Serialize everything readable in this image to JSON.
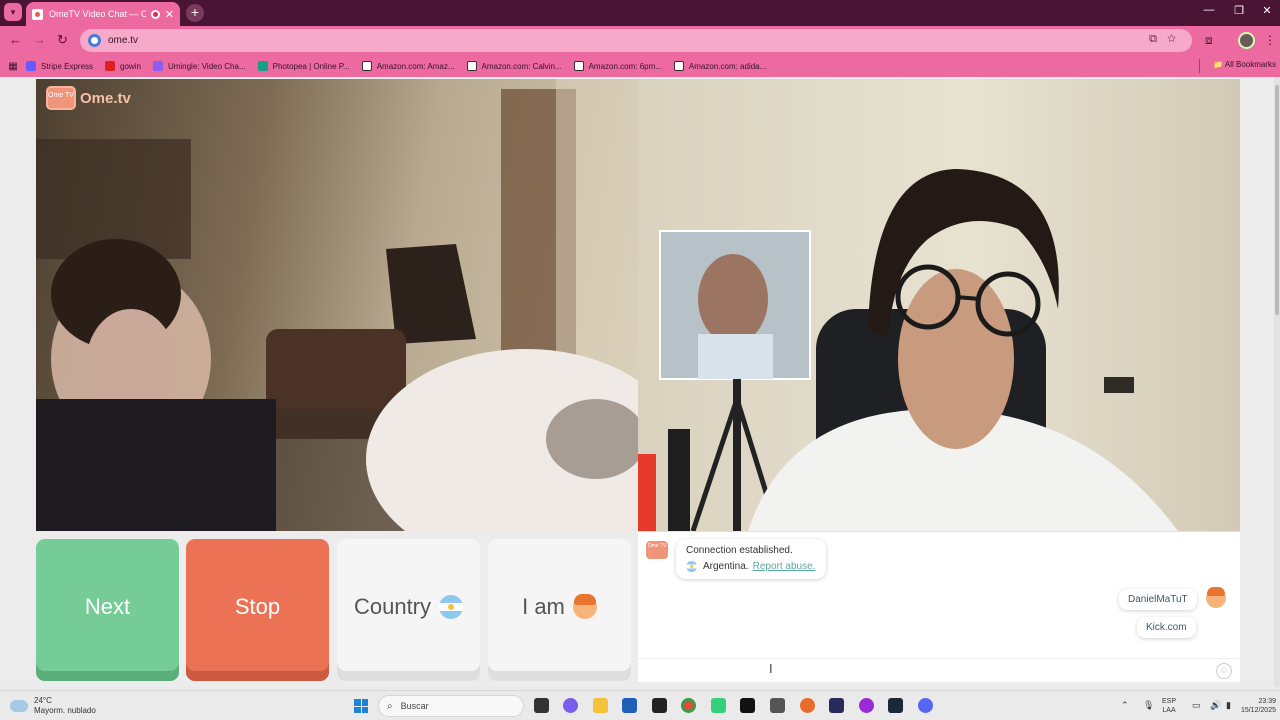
{
  "browser": {
    "tab_title": "OmeTV Video Chat — Ome",
    "new_tab_symbol": "+",
    "url": "ome.tv",
    "bookmarks": [
      {
        "label": "Stripe Express",
        "color": "#635bff"
      },
      {
        "label": "gowin",
        "color": "#e02020"
      },
      {
        "label": "Umingle: Video Cha...",
        "color": "#8a5cf0"
      },
      {
        "label": "Photopea | Online P...",
        "color": "#17a086"
      },
      {
        "label": "Amazon.com: Amaz...",
        "color": "#ffffff"
      },
      {
        "label": "Amazon.com: Calvin...",
        "color": "#ffffff"
      },
      {
        "label": "Amazon.com: 6pm...",
        "color": "#ffffff"
      },
      {
        "label": "Amazon.com: adida...",
        "color": "#ffffff"
      }
    ],
    "all_bookmarks": "All Bookmarks"
  },
  "site": {
    "logo_badge": "Ome TV",
    "logo_text": "Ome.tv",
    "buttons": {
      "next": "Next",
      "stop": "Stop",
      "country": "Country",
      "i_am": "I am"
    }
  },
  "chat": {
    "logo_badge": "Ome TV",
    "system_message": "Connection established.",
    "country": "Argentina.",
    "report_link": "Report abuse.",
    "my_messages": [
      "DanielMaTuT",
      "Kick.com"
    ]
  },
  "taskbar": {
    "temperature": "24°C",
    "weather": "Mayorm. nublado",
    "search_placeholder": "Buscar",
    "lang_top": "ESP",
    "lang_bottom": "LAA",
    "time": "23:39",
    "date": "15/12/2025"
  },
  "colors": {
    "tab_strip": "#4a1535",
    "chrome_pink": "#ec6aa0",
    "next_green": "#75cc96",
    "stop_orange": "#ec7255"
  }
}
